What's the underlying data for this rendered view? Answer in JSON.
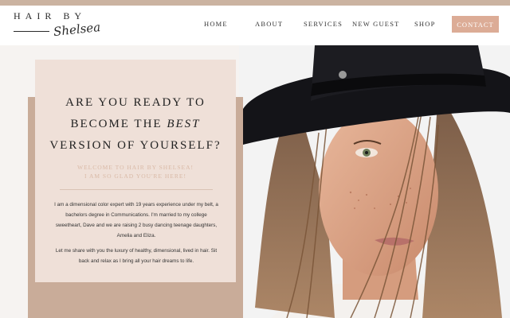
{
  "colors": {
    "accent": "#dcac96",
    "topbar": "#cbb3a1",
    "card_frame": "#c9ac99",
    "card_fill": "#efe0d8",
    "welcome_text": "#d9b9a6"
  },
  "logo": {
    "top": "HAIR BY",
    "script": "Shelsea"
  },
  "nav": {
    "items": [
      "HOME",
      "ABOUT",
      "SERVICES",
      "NEW GUEST",
      "SHOP"
    ],
    "contact": "CONTACT"
  },
  "hero": {
    "heading_line1": "ARE YOU READY TO",
    "heading_line2_pre": "BECOME THE ",
    "heading_line2_em": "BEST",
    "heading_line3": "VERSION OF YOURSELF?",
    "welcome_line1": "WELCOME TO HAIR BY SHELSEA!",
    "welcome_line2": "I AM SO GLAD YOU'RE HERE!",
    "paragraph1": "I am a dimensional color expert with 19 years experience under my belt, a bachelors degree in Communications. I'm married to my college sweetheart, Dave and we are raising 2 busy dancing teenage daughters, Amelia and Eliza.",
    "paragraph2": "Let me share with you the luxury of healthy, dimensional, lived in hair. Sit back and relax as I bring all your hair dreams to life."
  }
}
